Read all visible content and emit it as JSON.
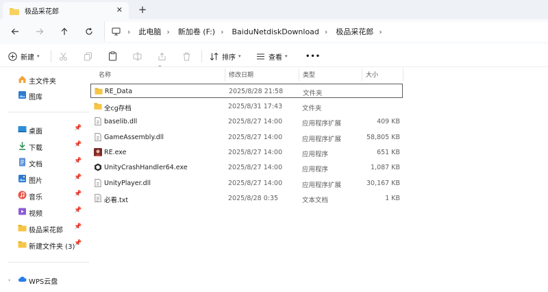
{
  "tab": {
    "title": "极品采花郎"
  },
  "breadcrumbs": [
    "此电脑",
    "新加卷 (F:)",
    "BaiduNetdiskDownload",
    "极品采花郎"
  ],
  "toolbar": {
    "new_label": "新建",
    "sort_label": "排序",
    "view_label": "查看",
    "more_label": "•••"
  },
  "sidebar": {
    "top": [
      {
        "label": "主文件夹",
        "icon": "home-icon"
      },
      {
        "label": "图库",
        "icon": "gallery-icon"
      }
    ],
    "pinned": [
      {
        "label": "桌面",
        "icon": "desktop-icon"
      },
      {
        "label": "下载",
        "icon": "download-icon"
      },
      {
        "label": "文档",
        "icon": "document-icon"
      },
      {
        "label": "图片",
        "icon": "pictures-icon"
      },
      {
        "label": "音乐",
        "icon": "music-icon"
      },
      {
        "label": "视频",
        "icon": "video-icon"
      },
      {
        "label": "极品采花郎",
        "icon": "folder-icon"
      },
      {
        "label": "新建文件夹 (3)",
        "icon": "folder-icon"
      }
    ],
    "cloud": {
      "label": "WPS云盘",
      "icon": "cloud-icon"
    }
  },
  "columns": {
    "name": "名称",
    "modified": "修改日期",
    "type": "类型",
    "size": "大小"
  },
  "files": [
    {
      "name": "RE_Data",
      "modified": "2025/8/28 21:58",
      "type": "文件夹",
      "size": "",
      "icon": "folder-icon"
    },
    {
      "name": "全cg存档",
      "modified": "2025/8/31 17:43",
      "type": "文件夹",
      "size": "",
      "icon": "folder-icon"
    },
    {
      "name": "baselib.dll",
      "modified": "2025/8/27 14:00",
      "type": "应用程序扩展",
      "size": "409 KB",
      "icon": "dll-file-icon"
    },
    {
      "name": "GameAssembly.dll",
      "modified": "2025/8/27 14:00",
      "type": "应用程序扩展",
      "size": "58,805 KB",
      "icon": "dll-file-icon"
    },
    {
      "name": "RE.exe",
      "modified": "2025/8/27 14:00",
      "type": "应用程序",
      "size": "651 KB",
      "icon": "app-icon"
    },
    {
      "name": "UnityCrashHandler64.exe",
      "modified": "2025/8/27 14:00",
      "type": "应用程序",
      "size": "1,087 KB",
      "icon": "unity-icon"
    },
    {
      "name": "UnityPlayer.dll",
      "modified": "2025/8/27 14:00",
      "type": "应用程序扩展",
      "size": "30,167 KB",
      "icon": "dll-file-icon"
    },
    {
      "name": "必看.txt",
      "modified": "2025/8/28 0:35",
      "type": "文本文档",
      "size": "1 KB",
      "icon": "text-file-icon"
    }
  ],
  "colors": {
    "folder": "#f6c545",
    "accent": "#0067c0",
    "selection_border": "#5a5a5a"
  }
}
